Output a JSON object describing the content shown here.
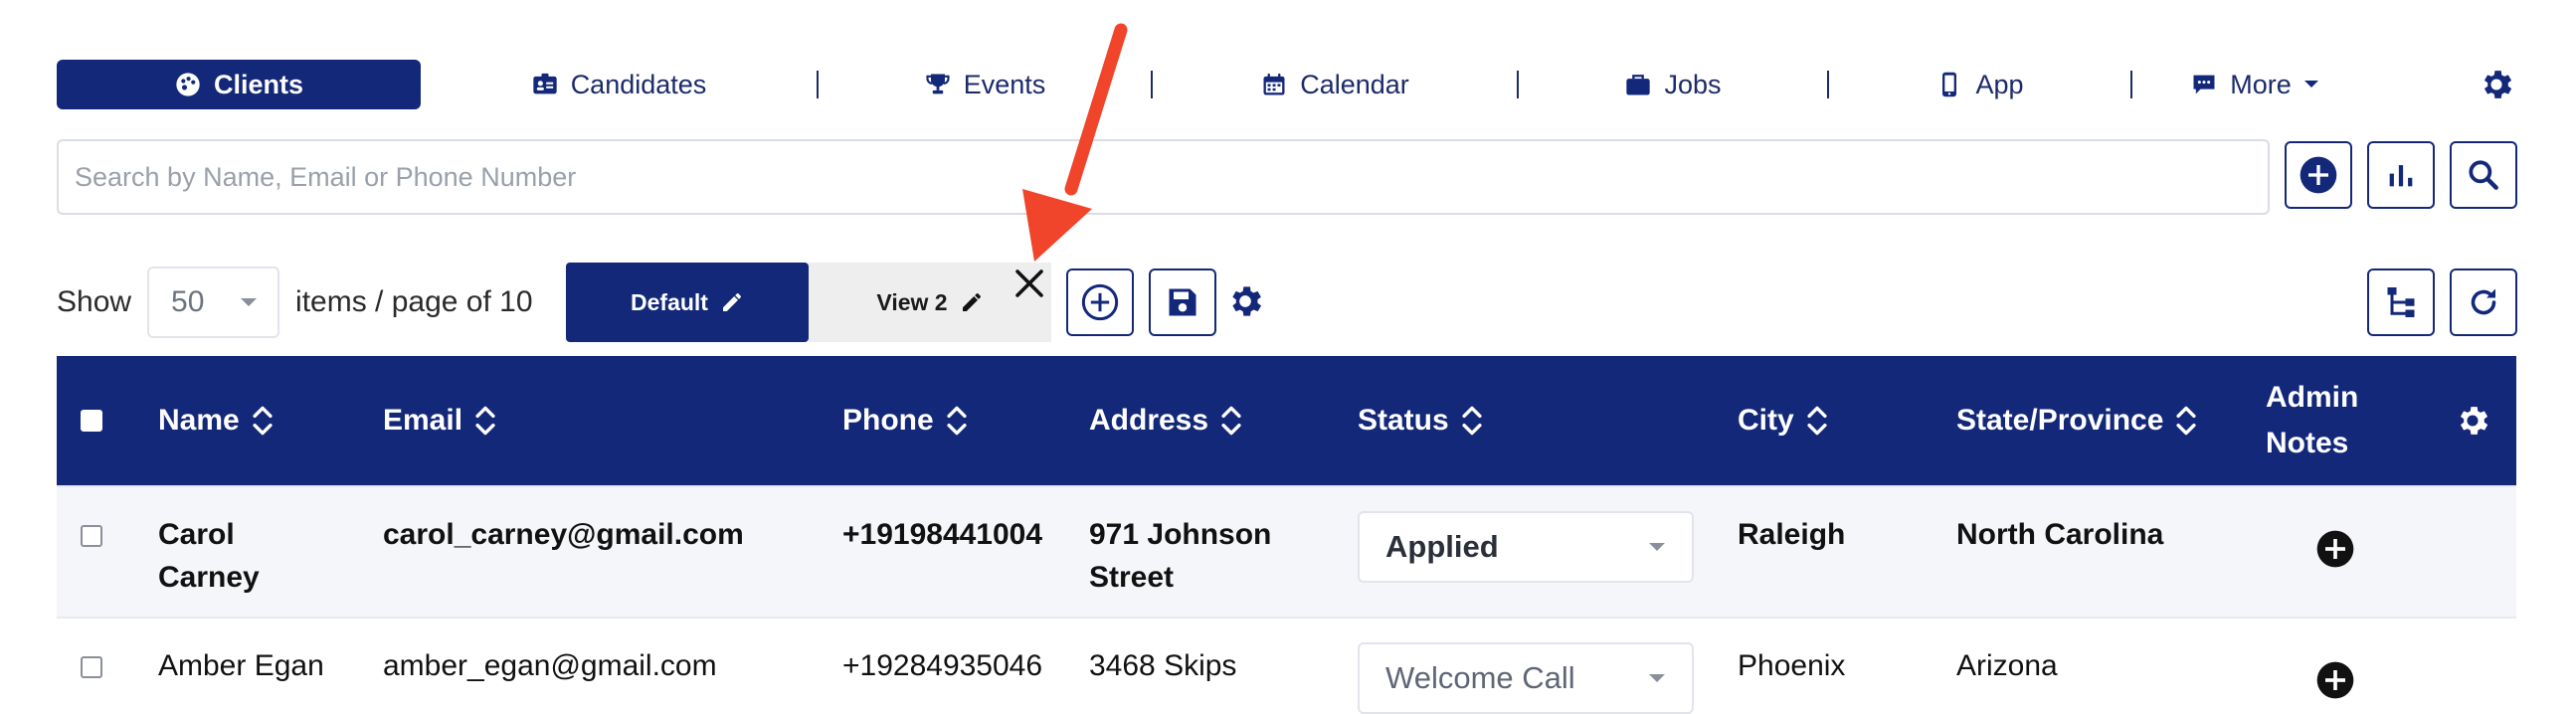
{
  "nav": {
    "items": [
      {
        "label": "Clients",
        "icon": "palette-icon",
        "active": true
      },
      {
        "label": "Candidates",
        "icon": "id-card-icon"
      },
      {
        "label": "Events",
        "icon": "trophy-icon"
      },
      {
        "label": "Calendar",
        "icon": "calendar-icon"
      },
      {
        "label": "Jobs",
        "icon": "briefcase-icon"
      },
      {
        "label": "App",
        "icon": "mobile-phone-icon"
      },
      {
        "label": "More",
        "icon": "comment-icon"
      }
    ]
  },
  "search": {
    "placeholder": "Search by Name, Email or Phone Number"
  },
  "pager": {
    "show_label": "Show",
    "page_size": "50",
    "items_label": "items / page of 10"
  },
  "views": {
    "default_label": "Default",
    "view2_label": "View 2"
  },
  "table": {
    "headers": {
      "name": "Name",
      "email": "Email",
      "phone": "Phone",
      "address": "Address",
      "status": "Status",
      "city": "City",
      "state": "State/Province",
      "admin_notes_1": "Admin",
      "admin_notes_2": "Notes"
    },
    "rows": [
      {
        "name_1": "Carol",
        "name_2": "Carney",
        "email": "carol_carney@gmail.com",
        "phone": "+19198441004",
        "address_1": "971 Johnson",
        "address_2": "Street",
        "status": "Applied",
        "city": "Raleigh",
        "state": "North Carolina"
      },
      {
        "name_1": "Amber Egan",
        "email": "amber_egan@gmail.com",
        "phone": "+19284935046",
        "address_1": "3468 Skips",
        "status": "Welcome Call",
        "city": "Phoenix",
        "state": "Arizona"
      }
    ]
  },
  "colors": {
    "primary": "#14287a",
    "row_highlight": "#f4f6f9",
    "annotation": "#f0452b"
  }
}
